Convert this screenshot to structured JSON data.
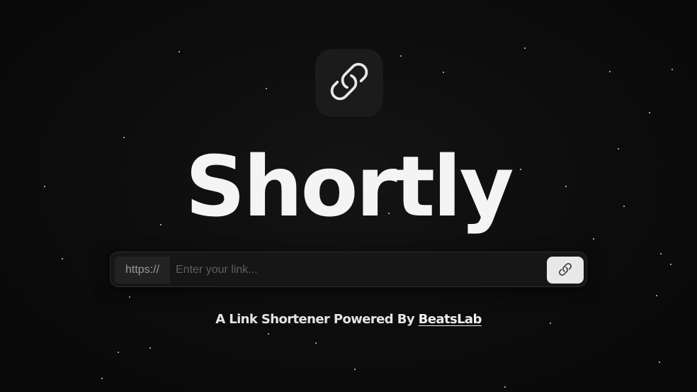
{
  "app": {
    "title": "Shortly"
  },
  "logo": {
    "icon": "link-icon"
  },
  "form": {
    "prefix": "https://",
    "input_value": "",
    "input_placeholder": "Enter your link...",
    "submit_icon": "link-icon"
  },
  "footer": {
    "tagline_text": "A Link Shortener Powered By ",
    "brand_link": "BeatsLab"
  },
  "colors": {
    "background": "#0b0b0b",
    "title": "#f4f4f4",
    "button": "#e8e8e8"
  }
}
